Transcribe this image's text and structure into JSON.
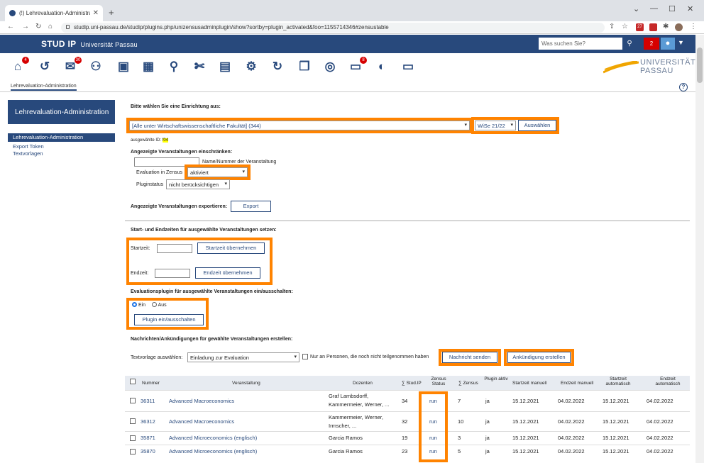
{
  "browser": {
    "tab_title": "(!) Lehrevaluation-Administration",
    "url": "studip.uni-passau.de/studip/plugins.php/unizensusadminplugin/show?sortby=plugin_activated&foo=1155714346#zensustable",
    "ext_badge": "27"
  },
  "header": {
    "logo": "STUD IP",
    "university": "Universität Passau",
    "search_placeholder": "Was suchen Sie?",
    "notification_count": "2",
    "uni_logo_line1": "UNIVERSITÄT",
    "uni_logo_line2": "PASSAU"
  },
  "nav_badges": {
    "start": "4",
    "messages": "30",
    "planner": "8"
  },
  "breadcrumb": "Lehrevaluation-Administration",
  "sidebar": {
    "title": "Lehrevaluation-Administration",
    "items": [
      "Lehrevaluation-Administration",
      "Export Token",
      "Textvorlagen"
    ]
  },
  "institute": {
    "heading": "Bitte wählen Sie eine Einrichtung aus:",
    "selected": "[Alle unter Wirtschaftswissenschaftliche Fakultät] (344)",
    "semester": "WiSe 21/22",
    "select_button": "Auswählen",
    "id_label": "ausgewählte ID:",
    "id_value": "f04"
  },
  "filter": {
    "heading": "Angezeigte Veranstaltungen einschränken:",
    "name_label": "Name/Nummer der Veranstaltung",
    "eval_label": "Evaluation in Zensus",
    "eval_value": "aktiviert",
    "plugin_label": "Pluginstatus",
    "plugin_value": "nicht berücksichtigen"
  },
  "export": {
    "label": "Angezeigte Veranstaltungen exportieren:",
    "button": "Export"
  },
  "times": {
    "heading": "Start- und Endzeiten für ausgewählte Veranstaltungen setzen:",
    "start_label": "Startzeit:",
    "start_button": "Startzeit übernehmen",
    "end_label": "Endzeit:",
    "end_button": "Endzeit übernehmen"
  },
  "plugin_toggle": {
    "heading": "Evaluationsplugin für ausgewählte Veranstaltungen ein/ausschalten:",
    "on": "Ein",
    "off": "Aus",
    "button": "Plugin ein/ausschalten"
  },
  "messages": {
    "heading": "Nachrichten/Ankündigungen für gewählte Veranstaltungen erstellen:",
    "template_label": "Textvorlage auswählen:",
    "template_value": "Einladung zur Evaluation",
    "only_label": "Nur an Personen, die noch nicht teilgenommen haben",
    "send_button": "Nachricht senden",
    "announce_button": "Ankündigung erstellen"
  },
  "table": {
    "headers": [
      "Nummer",
      "Veranstaltung",
      "Dozenten",
      "∑ Stud.IP",
      "Zensus Status",
      "∑ Zensus",
      "Plugin aktiv",
      "Startzeit manuell",
      "Endzeit manuell",
      "Startzeit automatisch",
      "Endzeit automatisch"
    ],
    "rows": [
      {
        "nr": "36311",
        "name": "Advanced Macroeconomics",
        "doz1": "Graf Lambsdorff,",
        "doz2": "Kammermeier, Werner, ...",
        "stud": "34",
        "status": "run",
        "zensus": "7",
        "plugin": "ja",
        "sm": "15.12.2021",
        "em": "04.02.2022",
        "sa": "15.12.2021",
        "ea": "04.02.2022"
      },
      {
        "nr": "36312",
        "name": "Advanced Macroeconomics",
        "doz1": "Kammermeier, Werner,",
        "doz2": "Irmscher, ...",
        "stud": "32",
        "status": "run",
        "zensus": "10",
        "plugin": "ja",
        "sm": "15.12.2021",
        "em": "04.02.2022",
        "sa": "15.12.2021",
        "ea": "04.02.2022"
      },
      {
        "nr": "35871",
        "name": "Advanced Microeconomics (englisch)",
        "doz1": "Garcia Ramos",
        "doz2": "",
        "stud": "19",
        "status": "run",
        "zensus": "3",
        "plugin": "ja",
        "sm": "15.12.2021",
        "em": "04.02.2022",
        "sa": "15.12.2021",
        "ea": "04.02.2022"
      },
      {
        "nr": "35870",
        "name": "Advanced Microeconomics (englisch)",
        "doz1": "Garcia Ramos",
        "doz2": "",
        "stud": "23",
        "status": "run",
        "zensus": "5",
        "plugin": "ja",
        "sm": "15.12.2021",
        "em": "04.02.2022",
        "sa": "15.12.2021",
        "ea": "04.02.2022"
      }
    ]
  },
  "colors": {
    "brand": "#28497c",
    "highlight": "#ff8300"
  }
}
